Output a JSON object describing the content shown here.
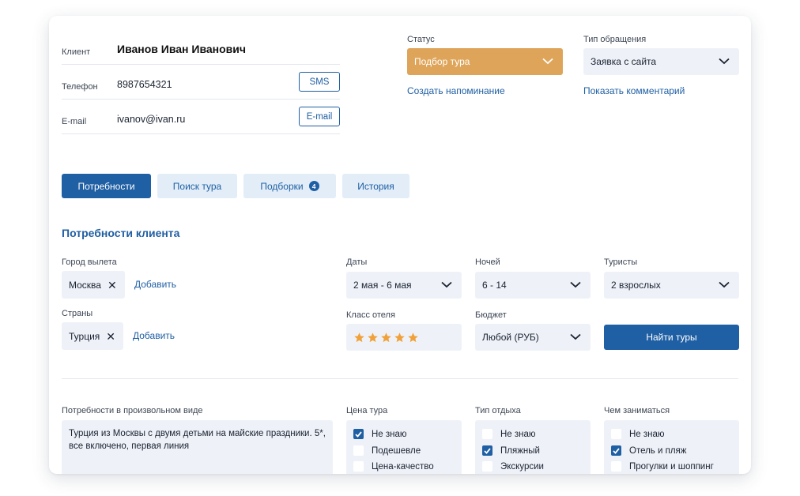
{
  "client": {
    "name_label": "Клиент",
    "name_value": "Иванов Иван Иванович",
    "phone_label": "Телефон",
    "phone_value": "8987654321",
    "sms_button": "SMS",
    "email_label": "E-mail",
    "email_value": "ivanov@ivan.ru",
    "email_button": "E-mail"
  },
  "status": {
    "label": "Статус",
    "value": "Подбор тура",
    "reminder_link": "Создать напоминание",
    "color": "#dea55a"
  },
  "request_type": {
    "label": "Тип обращения",
    "value": "Заявка с сайта",
    "comment_link": "Показать комментарий"
  },
  "tabs": [
    {
      "label": "Потребности",
      "active": true
    },
    {
      "label": "Поиск тура",
      "active": false
    },
    {
      "label": "Подборки",
      "active": false,
      "badge": "4"
    },
    {
      "label": "История",
      "active": false
    }
  ],
  "needs": {
    "title": "Потребности клиента",
    "departure_label": "Город вылета",
    "departure_chip": "Москва",
    "add_link": "Добавить",
    "countries_label": "Страны",
    "country_chip": "Турция",
    "dates_label": "Даты",
    "dates_value": "2 мая - 6 мая",
    "nights_label": "Ночей",
    "nights_value": "6 - 14",
    "tourists_label": "Туристы",
    "tourists_value": "2 взрослых",
    "hotel_class_label": "Класс отеля",
    "hotel_stars": 5,
    "budget_label": "Бюджет",
    "budget_value": "Любой (РУБ)",
    "find_button": "Найти туры"
  },
  "free_form": {
    "label": "Потребности в произвольном виде",
    "text": "Турция из Москвы с двумя детьми на майские праздники. 5*, все включено, первая линия"
  },
  "price": {
    "label": "Цена тура",
    "options": [
      {
        "label": "Не знаю",
        "checked": true
      },
      {
        "label": "Подешевле",
        "checked": false
      },
      {
        "label": "Цена-качество",
        "checked": false
      }
    ]
  },
  "rest_type": {
    "label": "Тип отдыха",
    "options": [
      {
        "label": "Не знаю",
        "checked": false
      },
      {
        "label": "Пляжный",
        "checked": true
      },
      {
        "label": "Экскурсии",
        "checked": false
      }
    ]
  },
  "activities": {
    "label": "Чем заниматься",
    "options": [
      {
        "label": "Не знаю",
        "checked": false
      },
      {
        "label": "Отель и пляж",
        "checked": true
      },
      {
        "label": "Прогулки и шоппинг",
        "checked": false
      }
    ]
  },
  "colors": {
    "primary": "#1f5fa3",
    "accent_orange": "#dea55a",
    "field_bg": "#eef2f8",
    "star": "#f0a13a"
  }
}
